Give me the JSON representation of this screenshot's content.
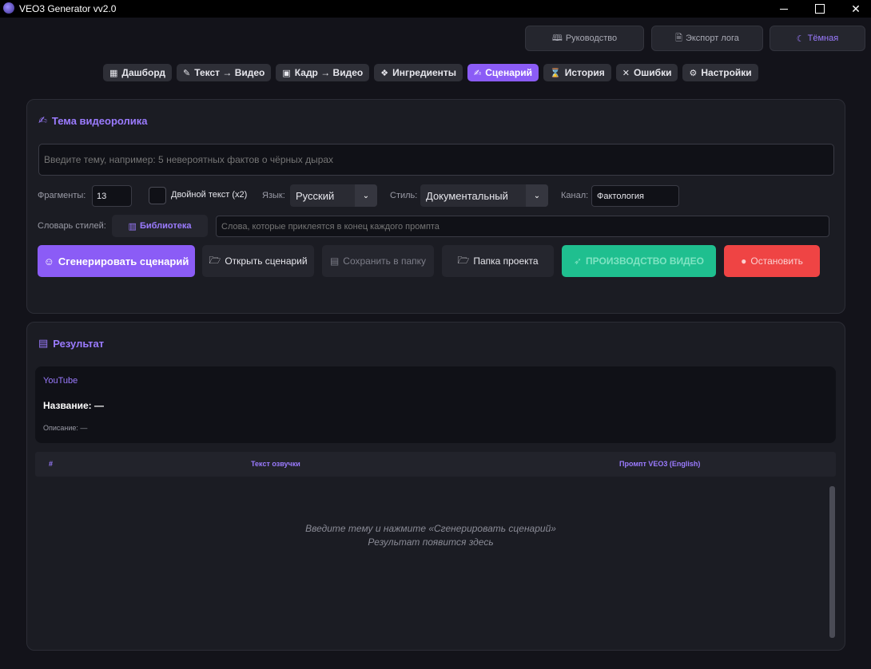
{
  "window": {
    "title": "VEO3 Generator vv2.0"
  },
  "top_buttons": {
    "guide": "Руководство",
    "export": "Экспорт лога",
    "theme": "Тёмная"
  },
  "tabs": [
    {
      "icon": "▦",
      "label": "Дашборд"
    },
    {
      "icon": "✎",
      "label": "Текст → Видео"
    },
    {
      "icon": "▣",
      "label": "Кадр → Видео"
    },
    {
      "icon": "❖",
      "label": "Ингредиенты"
    },
    {
      "icon": "✍",
      "label": "Сценарий"
    },
    {
      "icon": "⌛",
      "label": "История"
    },
    {
      "icon": "✕",
      "label": "Ошибки"
    },
    {
      "icon": "⚙",
      "label": "Настройки"
    }
  ],
  "topic": {
    "title": "Тема видеоролика",
    "placeholder": "Введите тему, например: 5 невероятных фактов о чёрных дырах",
    "fragments_label": "Фрагменты:",
    "fragments_value": "13",
    "double_text_label": "Двойной текст (x2)",
    "language_label": "Язык:",
    "language_value": "Русский",
    "style_label": "Стиль:",
    "style_value": "Документальный",
    "channel_label": "Канал:",
    "channel_value": "Фактология",
    "dictionary_label": "Словарь стилей:",
    "library_button": "Библиотека",
    "suffix_placeholder": "Слова, которые приклеятся в конец каждого промпта"
  },
  "actions": {
    "generate": "Сгенерировать сценарий",
    "open": "Открыть сценарий",
    "save": "Сохранить в папку",
    "folder": "Папка проекта",
    "produce": "ПРОИЗВОДСТВО ВИДЕО",
    "stop": "Остановить"
  },
  "result": {
    "title": "Результат",
    "youtube_label": "YouTube",
    "name_label": "Название: —",
    "description_label": "Описание: —",
    "columns": {
      "num": "#",
      "voice": "Текст озвучки",
      "prompt": "Промпт VEO3 (English)"
    },
    "empty_line1": "Введите тему и нажмите «Сгенерировать сценарий»",
    "empty_line2": "Результат появится здесь"
  },
  "colors": {
    "accent": "#8b5cf6",
    "success": "#1fbf8f",
    "danger": "#ef4444",
    "background": "#13131a",
    "panel": "#1b1c23"
  }
}
